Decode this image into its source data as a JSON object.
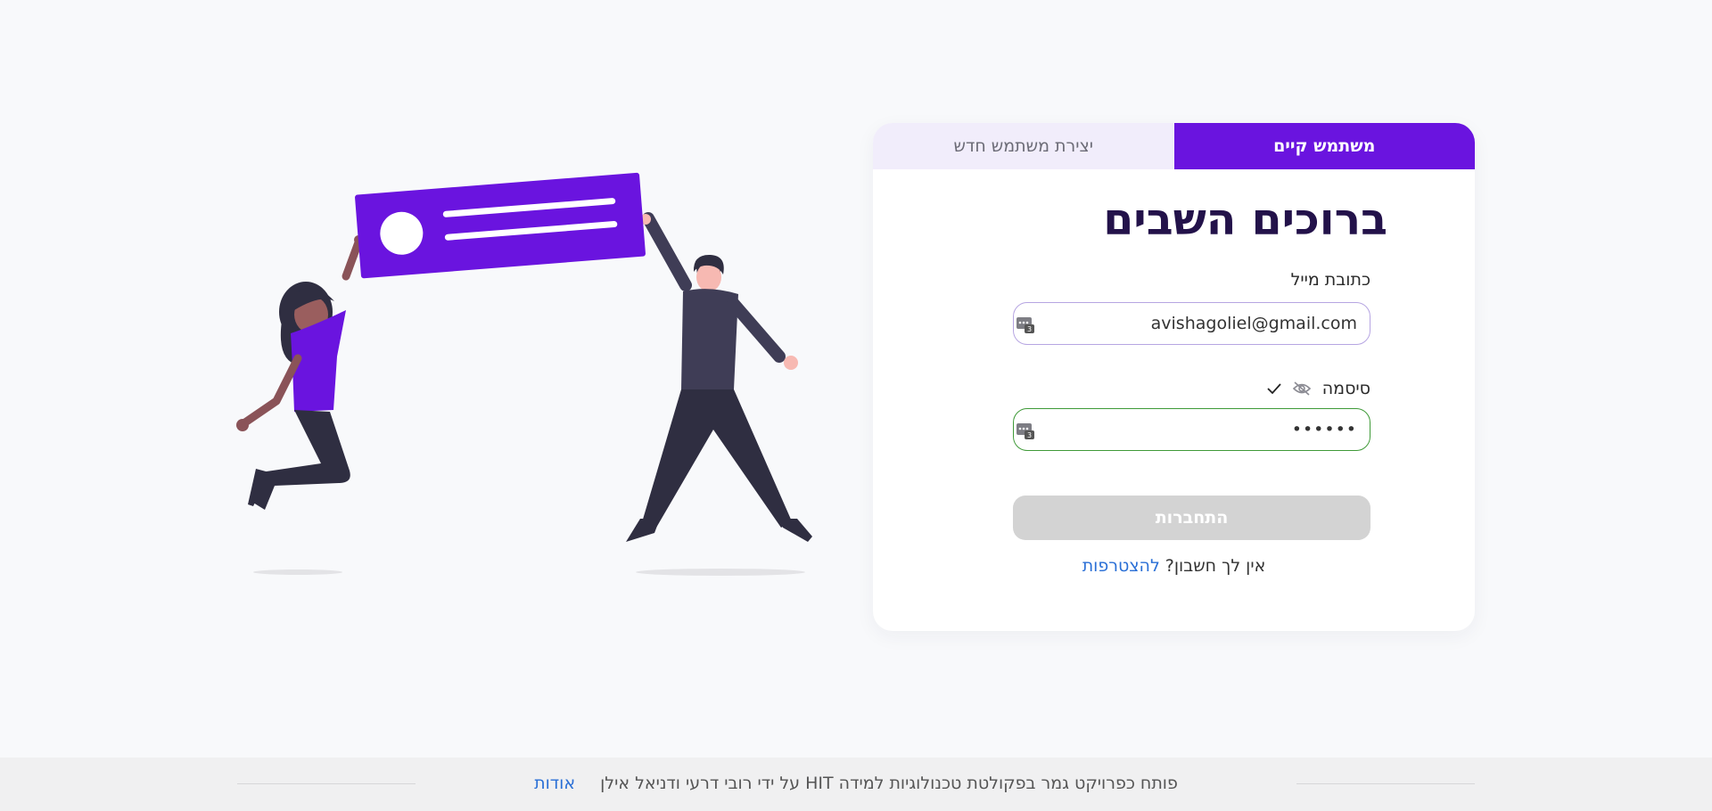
{
  "tabs": {
    "existing_user": "משתמש קיים",
    "new_user": "יצירת משתמש חדש"
  },
  "login": {
    "title": "ברוכים השבים",
    "email_label": "כתובת מייל",
    "email_value": "avishagoliel@gmail.com",
    "password_label": "סיסמה",
    "password_value": "••••••",
    "submit_label": "התחברות",
    "no_account_text": "אין לך חשבון?",
    "signup_link": "להצטרפות"
  },
  "icons": {
    "password_visibility": "eye-off-icon",
    "password_valid": "check-icon",
    "field_autofill": "key-icon"
  },
  "footer": {
    "text": "פותח כפרויקט גמר בפקולטת טכנולוגיות למידה HIT על ידי רובי דרעי ודניאל אילן",
    "about_link": "אודות"
  },
  "colors": {
    "accent": "#6a14df",
    "title": "#23124a",
    "link": "#2a6fd6",
    "valid_border": "#3f9a38",
    "disabled_button": "#d3d3d3"
  }
}
